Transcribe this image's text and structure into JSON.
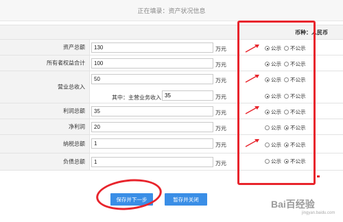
{
  "header": {
    "title": "正在填录：资产状况信息"
  },
  "currency": {
    "label": "币种：人民币"
  },
  "option_labels": {
    "show": "公示",
    "hide": "不公示"
  },
  "rows": [
    {
      "label": "资产总额",
      "value": "130",
      "unit": "万元",
      "selected": "show"
    },
    {
      "label": "所有者权益合计",
      "value": "100",
      "unit": "万元",
      "selected": "show"
    },
    {
      "label": "营业总收入",
      "value": "50",
      "unit": "万元",
      "selected": "show"
    },
    {
      "label": "利润总额",
      "value": "35",
      "unit": "万元",
      "selected": "show"
    },
    {
      "label": "净利润",
      "value": "20",
      "unit": "万元",
      "selected": "hide"
    },
    {
      "label": "纳税总额",
      "value": "1",
      "unit": "万元",
      "selected": "hide"
    },
    {
      "label": "负债总额",
      "value": "1",
      "unit": "万元",
      "selected": "hide"
    }
  ],
  "sub_row": {
    "label": "其中：主营业务收入",
    "value": "35",
    "unit": "万元",
    "selected": "show"
  },
  "buttons": {
    "save_next": "保存并下一步",
    "save_close": "暂存并关闭"
  },
  "watermark": {
    "text": "Bai百经验",
    "sub": "jingyan.baidu.com"
  },
  "colors": {
    "accent_button": "#3a8ee6",
    "annotation_red": "#e8242c"
  }
}
